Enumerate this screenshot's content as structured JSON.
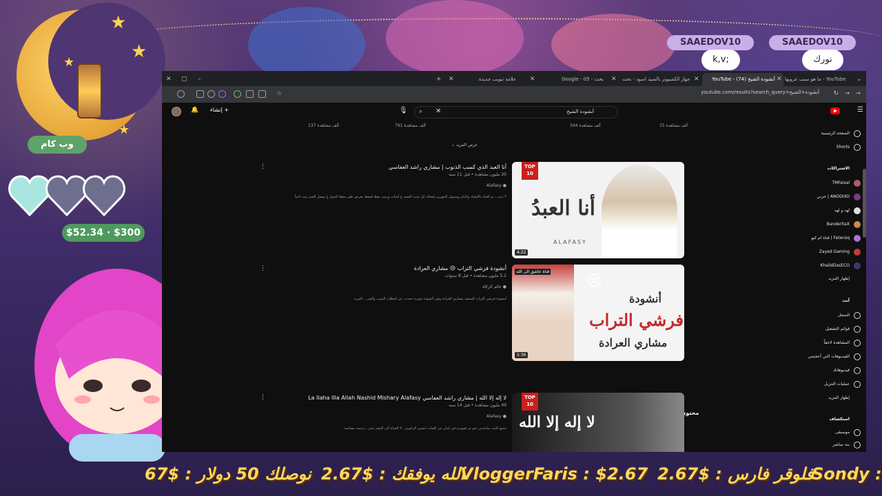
{
  "overlay": {
    "badge_label": "وب كام",
    "goal_text": "$52.34 · $300",
    "chat": [
      {
        "name": "SAAEDOV10",
        "message": "k,v;"
      },
      {
        "name": "SAAEDOV10",
        "message": "نورك"
      }
    ],
    "ticker": [
      "67$ : نوصلك 50 دولار",
      "2.67$ : الله يوفقك",
      "VloggerFaris : $2.67",
      "2.67$ : فلوقر فارس",
      "Sondy : $"
    ]
  },
  "browser": {
    "tabs": [
      {
        "label": "ما هو سبب غروبها - YouTube",
        "active": false
      },
      {
        "label": "YouTube - أنشودة الشيخ (74)",
        "active": true
      },
      {
        "label": "جهاز الكمبيوتر بالسيد اسود - بحث",
        "active": false
      },
      {
        "label": "Google - بحث - 05",
        "active": false
      },
      {
        "label": "علامة تبويب جديدة",
        "active": false
      }
    ],
    "url": "youtube.com/results?search_query=أنشودة+الشيخ"
  },
  "youtube": {
    "search_query": "أنشودة الشيخ",
    "create_label": "إنشاء",
    "views_row": [
      "15 ألف مشاهدة",
      "344 ألف مشاهدة",
      "791 ألف مشاهدة",
      "137 ألف مشاهدة"
    ],
    "show_more": "عرض المزيد",
    "section_heading": "محتوى شاهده مستخدمون آخرون",
    "videos": [
      {
        "title": "أنا العبد الذي كسب الذنوب | مشاري راشد العفاسي",
        "meta": "20 مليون مشاهدة • قبل 11 سنة",
        "channel": "Alafasy",
        "description": "7 ذنب ، ثم الغناء بالإنشاد والذكر وشمول الجهرين إيصالة كل جديد العسد ع ايجاب ورمت بقط لحفظ معرض طبر معظ الجمل ع توصل العمر شة دائماً",
        "duration": "4:22",
        "top10": "TOP 10",
        "thumb_caption": "أنا العبدُ",
        "thumb_sub": "ALAFASY"
      },
      {
        "title": "أنشودة فرشي التراب 😢 مشاري العرادة",
        "meta": "5.2 مليون مشاهدة • قبل 8 سنوات",
        "channel": "عالم الزكاة",
        "description": "أنشودة فرشي التراب للمنشد مشاري العرادة وهي أنشودة مؤثرة تتحدث عن لحظات الموت والقبر... المزيد",
        "duration": "5:36",
        "thumb_line1": "أنشودة",
        "thumb_line2": "فرشي التراب",
        "thumb_line3": "مشاري العرادة",
        "thumb_tag": "قناة عاشق الى الله"
      },
      {
        "title": "لا إله إلا الله | مشاري راشد العفاسي La Ilaha Illa Allah Nashid Mishary Alafasy",
        "meta": "49 مليون مشاهدة • قبل 14 سنة",
        "channel": "Alafasy",
        "description": "جميع كليب ساعدني نحو تم تصويره في لبنان من كلمات حسين الرابوني ، لا الحياة الى المجر نحن ،  ترجمة مصاحبة",
        "top10": "TOP 10",
        "thumb_caption": "لا إله إلا الله"
      }
    ],
    "sidebar": {
      "home": "الصفحة الرئيسية",
      "shorts": "Shorts",
      "subs_heading": "الاشتراكات",
      "subscriptions": [
        "TMFaisal",
        "ANODIXO | حزني",
        "لهد و لهد",
        "BanderitaX",
        "Fatensq | قناة ام كيو",
        "Zayed Gaming",
        "KhalidDasECO"
      ],
      "show_more_subs": "إظهار المزيد",
      "you_heading": "أنت",
      "you_items": [
        "السجل",
        "قوائم التشغيل",
        "المشاهدة لاحقاً",
        "الفيديوهات التي أعجبتني",
        "فيديوهاتك",
        "عمليات التنزيل",
        "إظهار المزيد"
      ],
      "explore_heading": "استكشاف",
      "explore_items": [
        "موسيقى",
        "بث مباشر"
      ]
    }
  }
}
